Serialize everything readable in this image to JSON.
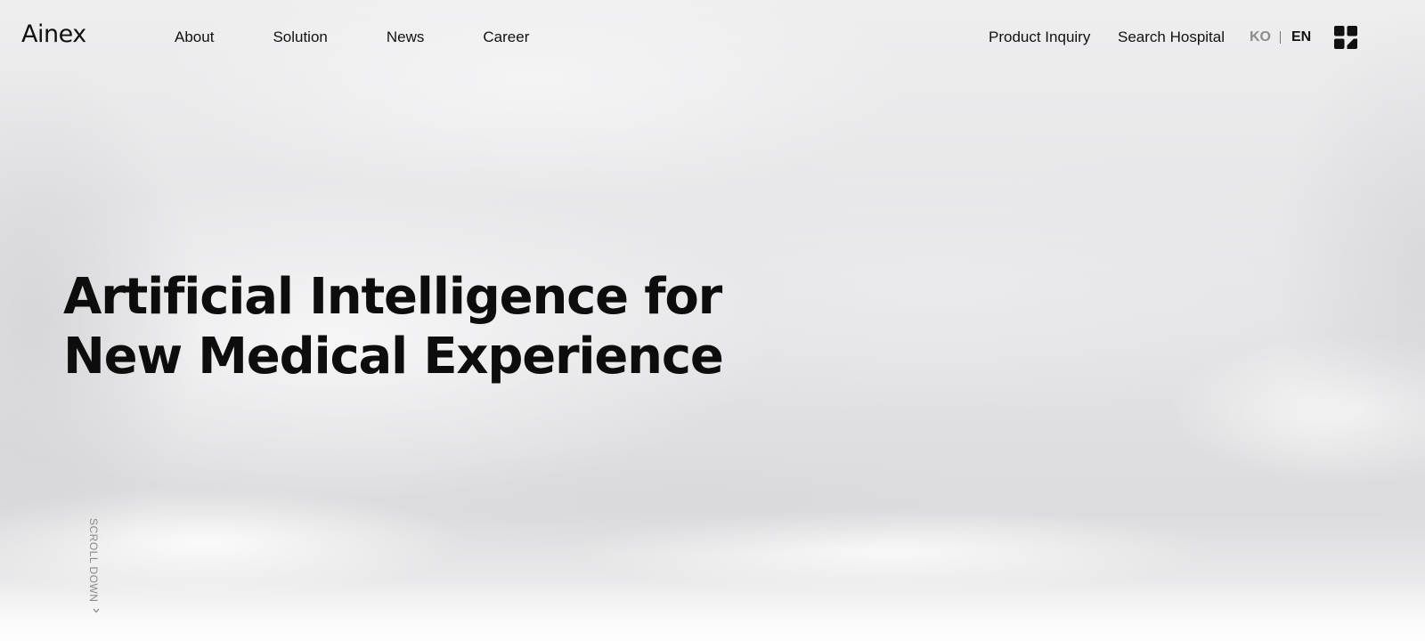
{
  "header": {
    "logo": "Ainex",
    "nav": [
      {
        "label": "About"
      },
      {
        "label": "Solution"
      },
      {
        "label": "News"
      },
      {
        "label": "Career"
      }
    ],
    "utility_links": {
      "product_inquiry": "Product Inquiry",
      "search_hospital": "Search Hospital"
    },
    "languages": {
      "ko": "KO",
      "en": "EN",
      "active": "EN"
    },
    "menu_icon": "grid-menu-icon"
  },
  "hero": {
    "title_line1": "Artificial Intelligence for",
    "title_line2": "New Medical Experience",
    "scroll_label": "SCROLL DOWN",
    "scroll_icon": "chevron-down-icon"
  },
  "colors": {
    "text": "#0d0d0d",
    "muted": "#8c8c8c",
    "background": "#e6e6e8"
  }
}
